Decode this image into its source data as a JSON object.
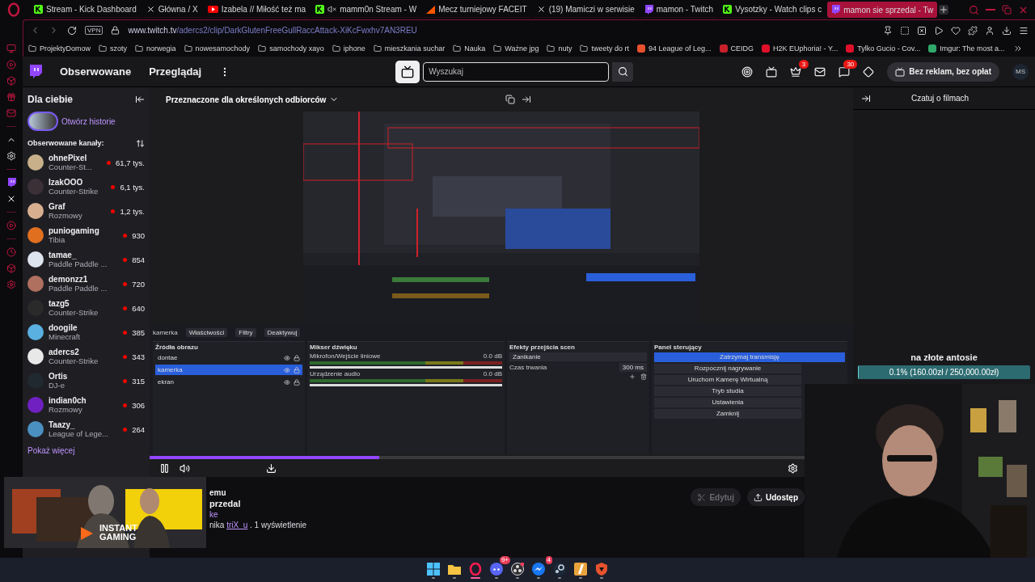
{
  "browser": {
    "tabs": [
      {
        "title": "Stream - Kick Dashboard",
        "kind": "kick",
        "muted": false,
        "selected": false
      },
      {
        "title": "Główna / X",
        "kind": "x",
        "muted": false,
        "selected": false
      },
      {
        "title": "Izabela // Miłość też ma",
        "kind": "youtube",
        "muted": false,
        "selected": false
      },
      {
        "title": "mamm0n Stream - W",
        "kind": "kick",
        "muted": true,
        "selected": false
      },
      {
        "title": "Mecz turniejowy FACEIT",
        "kind": "faceit",
        "muted": false,
        "selected": false
      },
      {
        "title": "(19) Mamiczi w serwisie",
        "kind": "x",
        "muted": false,
        "selected": false
      },
      {
        "title": "mamon - Twitch",
        "kind": "twitch",
        "muted": false,
        "selected": false
      },
      {
        "title": "Vysotzky - Watch clips c",
        "kind": "kick",
        "muted": false,
        "selected": false
      },
      {
        "title": "mamon sie sprzedal - Tw",
        "kind": "twitch",
        "muted": false,
        "selected": true
      }
    ],
    "vpn": "VPN",
    "url": "www.twitch.tv/adercs2/clip/DarkGlutenFreeGullRaccAttack-XiKcFwxhv7AN3REU",
    "bookmarks": [
      {
        "label": "ProjektyDomow",
        "kind": "folder"
      },
      {
        "label": "szoty",
        "kind": "folder"
      },
      {
        "label": "norwegia",
        "kind": "folder"
      },
      {
        "label": "nowesamochody",
        "kind": "folder"
      },
      {
        "label": "samochody xayo",
        "kind": "folder"
      },
      {
        "label": "iphone",
        "kind": "folder"
      },
      {
        "label": "mieszkania suchar",
        "kind": "folder"
      },
      {
        "label": "Nauka",
        "kind": "folder"
      },
      {
        "label": "Ważne jpg",
        "kind": "folder"
      },
      {
        "label": "nuty",
        "kind": "folder"
      },
      {
        "label": "tweety do rt",
        "kind": "folder"
      },
      {
        "label": "94 League of Leg...",
        "kind": "site",
        "color": "#e8512d"
      },
      {
        "label": "CEIDG",
        "kind": "site",
        "color": "#c8202a"
      },
      {
        "label": "H2K EUphoria! - Y...",
        "kind": "site",
        "color": "#e0102a"
      },
      {
        "label": "Tylko Gucio - Cov...",
        "kind": "site",
        "color": "#e0102a"
      },
      {
        "label": "Imgur: The most a...",
        "kind": "site",
        "color": "#2fa86a"
      }
    ]
  },
  "header": {
    "nav": [
      "Obserwowane",
      "Przeglądaj"
    ],
    "search": {
      "placeholder": "Wyszukaj"
    },
    "icons": [
      {
        "kind": "target"
      },
      {
        "kind": "letters"
      },
      {
        "kind": "crown",
        "badge": "3"
      },
      {
        "kind": "mail"
      },
      {
        "kind": "chat",
        "badge": "30"
      },
      {
        "kind": "diamond"
      }
    ],
    "turbo": "Bez reklam, bez opłat",
    "avatar": "MS"
  },
  "sidebar": {
    "title": "Dla ciebie",
    "stories": "Otwórz historie",
    "section": "Obserwowane kanały:",
    "channels": [
      {
        "name": "ohnePixel",
        "game": "Counter-St...",
        "viewers": "61,7 tys."
      },
      {
        "name": "IzakOOO",
        "game": "Counter-Strike",
        "viewers": "6,1 tys."
      },
      {
        "name": "Graf",
        "game": "Rozmowy",
        "viewers": "1,2 tys."
      },
      {
        "name": "puniogaming",
        "game": "Tibia",
        "viewers": "930"
      },
      {
        "name": "tamae_",
        "game": "Paddle Paddle ...",
        "viewers": "854"
      },
      {
        "name": "demonzz1",
        "game": "Paddle Paddle ...",
        "viewers": "720"
      },
      {
        "name": "tazg5",
        "game": "Counter-Strike",
        "viewers": "640"
      },
      {
        "name": "doogile",
        "game": "Minecraft",
        "viewers": "385"
      },
      {
        "name": "adercs2",
        "game": "Counter-Strike",
        "viewers": "343"
      },
      {
        "name": "Ortis",
        "game": "DJ-e",
        "viewers": "315"
      },
      {
        "name": "indian0ch",
        "game": "Rozmowy",
        "viewers": "306"
      },
      {
        "name": "Taazy_",
        "game": "League of Lege...",
        "viewers": "264"
      }
    ],
    "more": "Pokaż więcej"
  },
  "video": {
    "audience": "Przeznaczone dla określonych odbiorców",
    "obs": {
      "scene": "kamerka",
      "toolbar": [
        "Właściwości",
        "Filtry",
        "Deaktywuj"
      ],
      "panels": [
        "Źródła obrazu",
        "Mikser dźwięku",
        "Efekty przejścia scen",
        "Panel sterujący"
      ],
      "sources": [
        {
          "name": "dontae",
          "selected": false
        },
        {
          "name": "kamerka",
          "selected": true
        },
        {
          "name": "ekran",
          "selected": false
        }
      ],
      "mixer": [
        {
          "name": "Mikrofon/Wejście liniowe",
          "reading": "0.0 dB",
          "level": 1
        },
        {
          "name": "Urządzenie audio",
          "reading": "0.0 dB",
          "level": 1
        }
      ],
      "transition": "Zanikanie",
      "duration_label": "Czas trwania",
      "duration": "300 ms",
      "controls": [
        {
          "label": "Zatrzymaj transmisję",
          "selected": true
        },
        {
          "label": "Rozpocznij nagrywanie",
          "selected": false
        },
        {
          "label": "Uruchom Kamerę Wirtualną",
          "selected": false
        },
        {
          "label": "Tryb studia",
          "selected": false
        },
        {
          "label": "Ustawienia",
          "selected": false
        },
        {
          "label": "Zamknij",
          "selected": false
        }
      ]
    },
    "progress": {
      "level": 0.35
    }
  },
  "clip": {
    "line1": "emu",
    "title": "przedal",
    "category": "ke",
    "by": "nika ",
    "author": "triX_u",
    "views": " . 1 wyświetlenie",
    "edit": "Edytuj",
    "share": "Udostęp"
  },
  "chat": {
    "title": "Czatuj o filmach",
    "goal_title": "na złote antosie",
    "goal": "0.1% (160.00zł / 250,000.00zł)",
    "level": 0.001
  },
  "ad": {
    "brand": "INSTANT GAMING"
  },
  "taskbar": [
    {
      "kind": "windows",
      "selected": false
    },
    {
      "kind": "folder",
      "selected": false
    },
    {
      "kind": "opera",
      "selected": true
    },
    {
      "kind": "discord",
      "badge": "9+",
      "selected": false
    },
    {
      "kind": "obs",
      "selected": false
    },
    {
      "kind": "messenger",
      "badge": "4",
      "selected": false
    },
    {
      "kind": "steam",
      "selected": false
    },
    {
      "kind": "cs",
      "selected": false
    },
    {
      "kind": "shield",
      "selected": false
    }
  ]
}
